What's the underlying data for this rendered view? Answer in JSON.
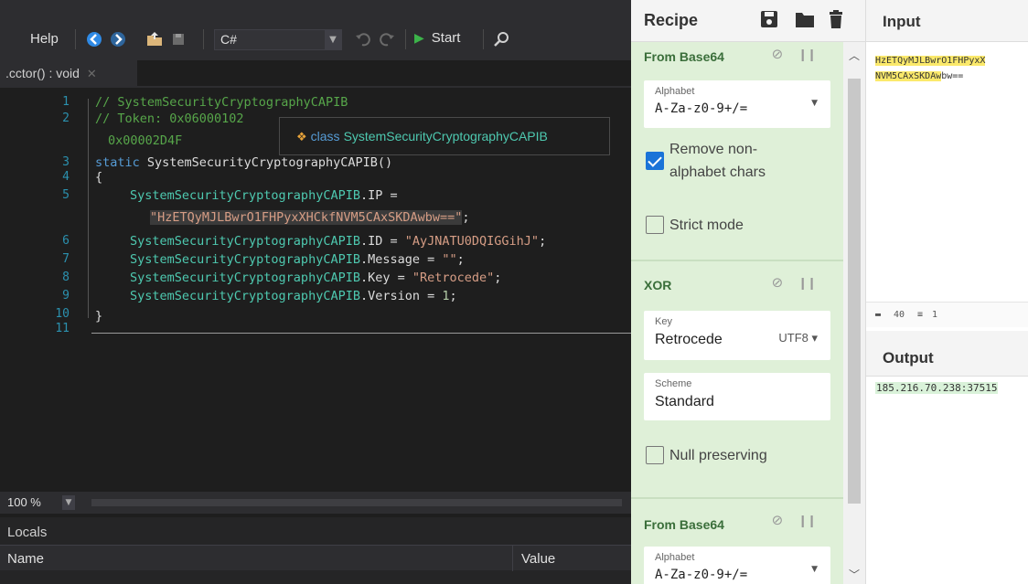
{
  "ide": {
    "menu_help": "Help",
    "language": "C#",
    "start_label": "Start",
    "doc_tab": ".cctor() : void",
    "tooltip_keyword": "class",
    "tooltip_type": "SystemSecurityCryptographyCAPIB",
    "line_numbers": [
      "1",
      "2",
      "3",
      "4",
      "5",
      "6",
      "7",
      "8",
      "9",
      "10",
      "11"
    ],
    "code": {
      "l1": "// SystemSecurityCryptographyCAPIB",
      "l2a": "// Token: 0x06000102",
      "l2b": "0x00002D4F",
      "l3_kw": "static",
      "l3_rest": " SystemSecurityCryptographyCAPIB()",
      "l4": "{",
      "l5_type": "SystemSecurityCryptographyCAPIB",
      "l5_rest": ".IP =",
      "l5_str": "\"HzETQyMJLBwrO1FHPyxXHCkfNVM5CAxSKDAwbw==\"",
      "l5_end": ";",
      "l6_type": "SystemSecurityCryptographyCAPIB",
      "l6_rest": ".ID = ",
      "l6_str": "\"AyJNATU0DQIGGihJ\"",
      "l6_end": ";",
      "l7_type": "SystemSecurityCryptographyCAPIB",
      "l7_rest": ".Message = ",
      "l7_str": "\"\"",
      "l7_end": ";",
      "l8_type": "SystemSecurityCryptographyCAPIB",
      "l8_rest": ".Key = ",
      "l8_str": "\"Retrocede\"",
      "l8_end": ";",
      "l9_type": "SystemSecurityCryptographyCAPIB",
      "l9_rest": ".Version = ",
      "l9_num": "1",
      "l9_end": ";",
      "l10": "}"
    },
    "zoom": "100 %",
    "locals_title": "Locals",
    "col_name": "Name",
    "col_value": "Value"
  },
  "recipe": {
    "title": "Recipe",
    "ops": [
      {
        "name": "From Base64",
        "alphabet_label": "Alphabet",
        "alphabet_value": "A-Za-z0-9+/=",
        "remove_nonalpha_label_1": "Remove non-",
        "remove_nonalpha_label_2": "alphabet chars",
        "remove_nonalpha_checked": true,
        "strict_label": "Strict mode",
        "strict_checked": false
      },
      {
        "name": "XOR",
        "key_label": "Key",
        "key_value": "Retrocede",
        "key_encoding": "UTF8",
        "scheme_label": "Scheme",
        "scheme_value": "Standard",
        "null_label": "Null preserving",
        "null_checked": false
      },
      {
        "name": "From Base64",
        "alphabet_label": "Alphabet",
        "alphabet_value": "A-Za-z0-9+/="
      }
    ]
  },
  "io": {
    "input_title": "Input",
    "input_line1": "HzETQyMJLBwrO1FHPyxX",
    "input_line2_hl": "NVM5CAxSKDAw",
    "input_line2_rest": "bw==",
    "stat_length": "40",
    "stat_lines": "1",
    "output_title": "Output",
    "output_value": "185.216.70.238:37515"
  },
  "colors": {
    "ide_bg": "#1e1e1e",
    "recipe_op_bg": "#dff0d8",
    "input_highlight": "#fbe96b",
    "output_highlight": "#d9f2d9"
  }
}
